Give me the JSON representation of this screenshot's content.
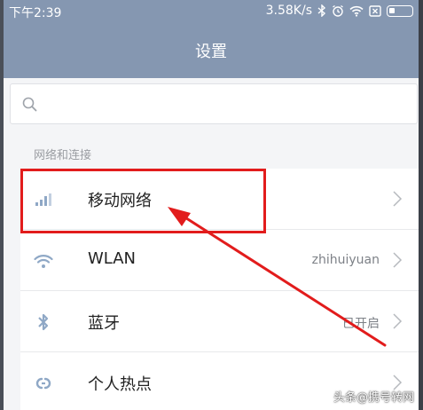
{
  "statusbar": {
    "time": "下午2:39",
    "network_speed": "3.58K/s",
    "icons": [
      "bluetooth-icon",
      "alarm-icon",
      "wifi-icon",
      "sim-icon",
      "battery-icon"
    ]
  },
  "header": {
    "title": "设置"
  },
  "search": {
    "placeholder": ""
  },
  "section": {
    "title": "网络和连接"
  },
  "items": [
    {
      "label": "移动网络",
      "value": "",
      "icon": "signal-icon"
    },
    {
      "label": "WLAN",
      "value": "zhihuiyuan",
      "icon": "wifi-icon"
    },
    {
      "label": "蓝牙",
      "value": "已开启",
      "icon": "bluetooth-icon"
    },
    {
      "label": "个人热点",
      "value": "",
      "icon": "hotspot-icon"
    }
  ],
  "watermark": "头条@携号转网",
  "colors": {
    "header_bg": "#8597b1",
    "icon_blue": "#8fa8c6",
    "annotation_red": "#e21c1c"
  }
}
